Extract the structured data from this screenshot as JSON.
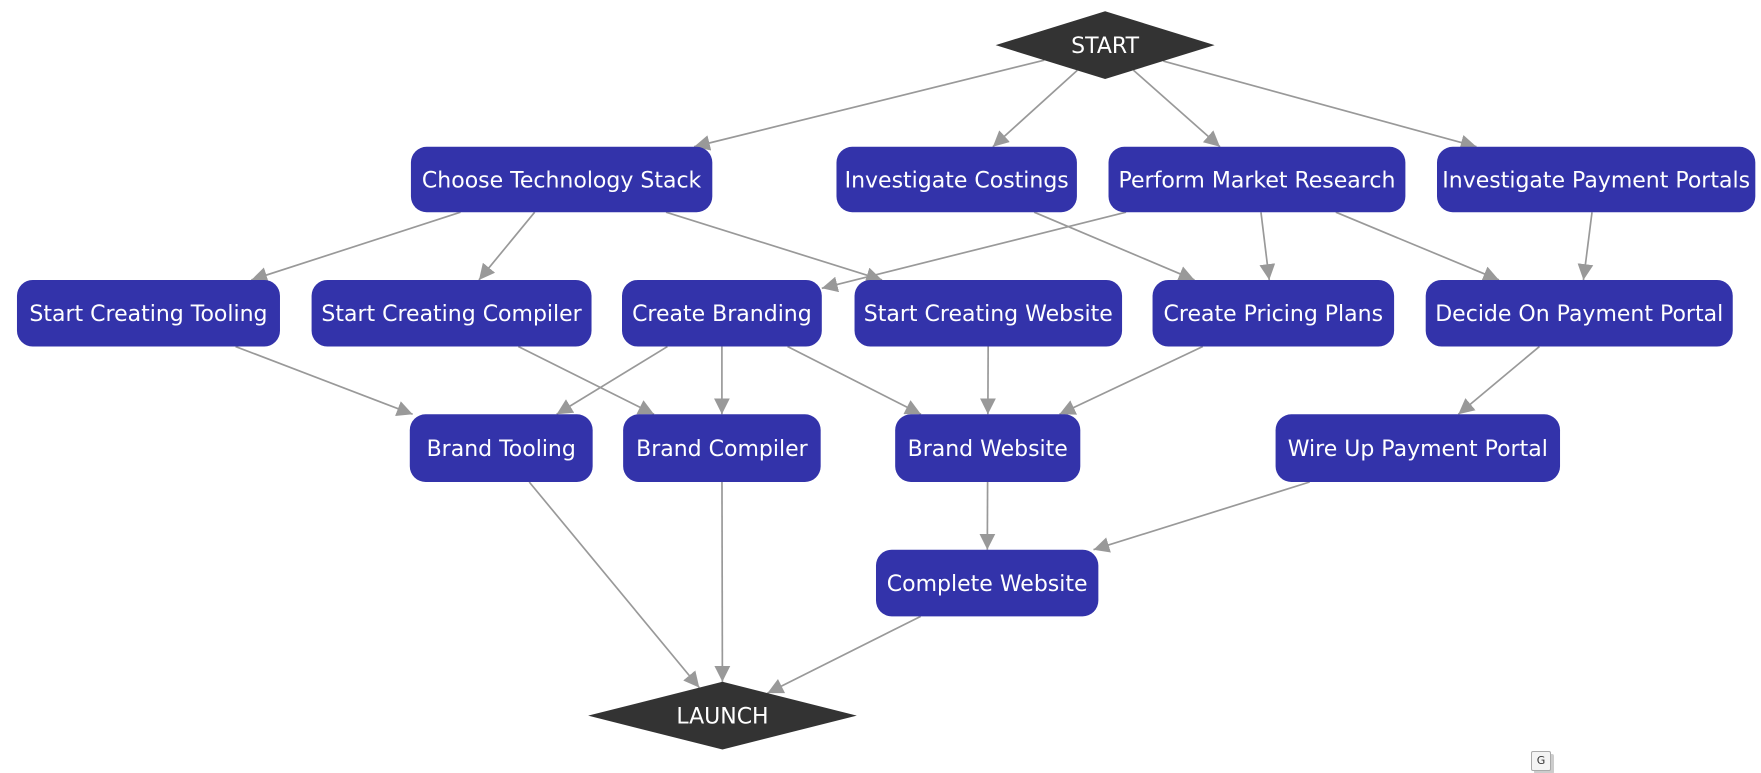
{
  "colors": {
    "task_fill": "#3333aa",
    "milestone_fill": "#333333",
    "task_text": "#ffffff",
    "milestone_text": "#e8e8e8",
    "edge": "#999999"
  },
  "nodes": [
    {
      "id": "start",
      "label": "START",
      "shape": "diamond"
    },
    {
      "id": "tech",
      "label": "Choose Technology Stack",
      "shape": "rounded-rect"
    },
    {
      "id": "costings",
      "label": "Investigate Costings",
      "shape": "rounded-rect"
    },
    {
      "id": "market",
      "label": "Perform Market Research",
      "shape": "rounded-rect"
    },
    {
      "id": "portals",
      "label": "Investigate Payment Portals",
      "shape": "rounded-rect"
    },
    {
      "id": "tooling",
      "label": "Start Creating Tooling",
      "shape": "rounded-rect"
    },
    {
      "id": "compiler",
      "label": "Start Creating Compiler",
      "shape": "rounded-rect"
    },
    {
      "id": "branding",
      "label": "Create Branding",
      "shape": "rounded-rect"
    },
    {
      "id": "website",
      "label": "Start Creating Website",
      "shape": "rounded-rect"
    },
    {
      "id": "pricing",
      "label": "Create Pricing Plans",
      "shape": "rounded-rect"
    },
    {
      "id": "decide",
      "label": "Decide On Payment Portal",
      "shape": "rounded-rect"
    },
    {
      "id": "btooling",
      "label": "Brand Tooling",
      "shape": "rounded-rect"
    },
    {
      "id": "bcompiler",
      "label": "Brand Compiler",
      "shape": "rounded-rect"
    },
    {
      "id": "bwebsite",
      "label": "Brand Website",
      "shape": "rounded-rect"
    },
    {
      "id": "wire",
      "label": "Wire Up Payment Portal",
      "shape": "rounded-rect"
    },
    {
      "id": "complete",
      "label": "Complete Website",
      "shape": "rounded-rect"
    },
    {
      "id": "launch",
      "label": "LAUNCH",
      "shape": "diamond"
    }
  ],
  "edges": [
    [
      "start",
      "tech"
    ],
    [
      "start",
      "costings"
    ],
    [
      "start",
      "market"
    ],
    [
      "start",
      "portals"
    ],
    [
      "tech",
      "tooling"
    ],
    [
      "tech",
      "compiler"
    ],
    [
      "tech",
      "website"
    ],
    [
      "market",
      "branding"
    ],
    [
      "market",
      "pricing"
    ],
    [
      "market",
      "decide"
    ],
    [
      "costings",
      "pricing"
    ],
    [
      "portals",
      "decide"
    ],
    [
      "tooling",
      "btooling"
    ],
    [
      "compiler",
      "bcompiler"
    ],
    [
      "branding",
      "btooling"
    ],
    [
      "branding",
      "bcompiler"
    ],
    [
      "branding",
      "bwebsite"
    ],
    [
      "website",
      "bwebsite"
    ],
    [
      "pricing",
      "bwebsite"
    ],
    [
      "decide",
      "wire"
    ],
    [
      "wire",
      "complete"
    ],
    [
      "bwebsite",
      "complete"
    ],
    [
      "btooling",
      "launch"
    ],
    [
      "bcompiler",
      "launch"
    ],
    [
      "complete",
      "launch"
    ]
  ],
  "corner_button": {
    "label": "G",
    "icon": "graph-toggle-icon"
  }
}
